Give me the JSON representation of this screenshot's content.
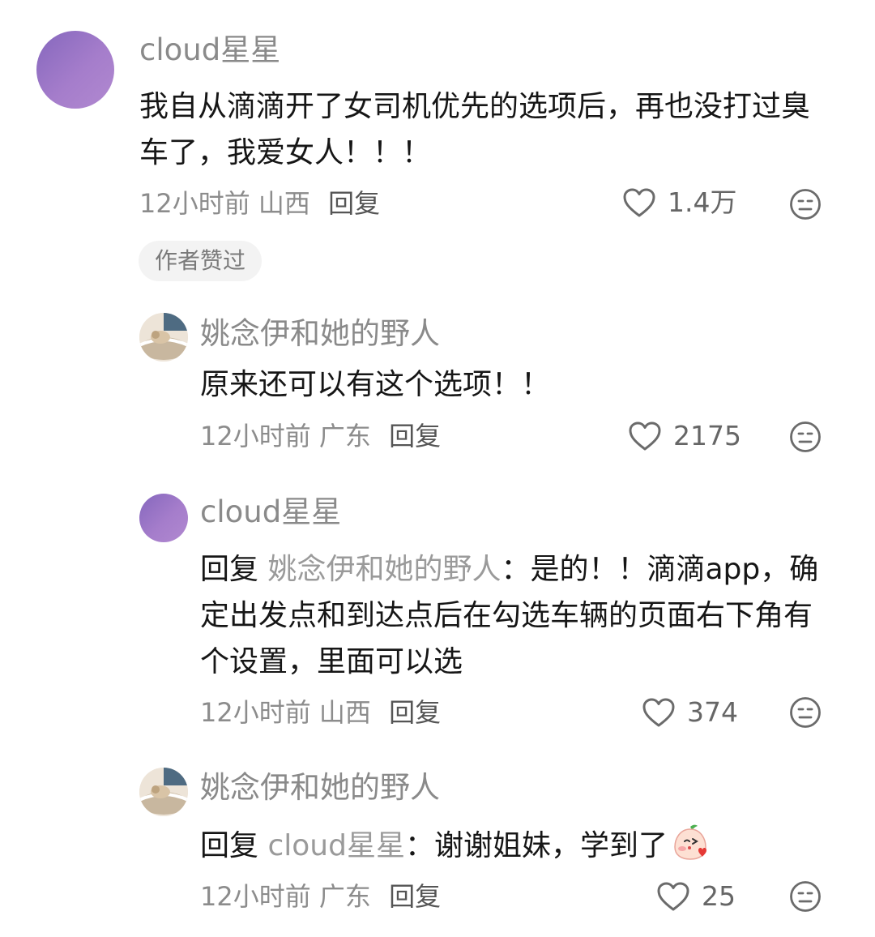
{
  "comments": [
    {
      "username": "cloud星星",
      "text": "我自从滴滴开了女司机优先的选项后，再也没打过臭车了，我爱女人！！！",
      "time": "12小时前",
      "location": "山西",
      "reply_label": "回复",
      "likes": "1.4万",
      "badge": "作者赞过",
      "avatar": "purple-gradient"
    },
    {
      "username": "姚念伊和她的野人",
      "text": "原来还可以有这个选项！！",
      "time": "12小时前",
      "location": "广东",
      "reply_label": "回复",
      "likes": "2175",
      "avatar": "cat-photo"
    },
    {
      "username": "cloud星星",
      "reply_prefix": "回复",
      "reply_to": "姚念伊和她的野人",
      "reply_sep": "：",
      "text": "是的！！滴滴app，确定出发点和到达点后在勾选车辆的页面右下角有个设置，里面可以选",
      "time": "12小时前",
      "location": "山西",
      "reply_label": "回复",
      "likes": "374",
      "avatar": "purple-gradient"
    },
    {
      "username": "姚念伊和她的野人",
      "reply_prefix": "回复",
      "reply_to": "cloud星星",
      "reply_sep": "：",
      "text": "谢谢姐妹，学到了",
      "sticker": "peach-kiss-emoji",
      "time": "12小时前",
      "location": "广东",
      "reply_label": "回复",
      "likes": "25",
      "avatar": "cat-photo"
    }
  ],
  "icons": {
    "like": "heart-outline-icon",
    "more": "meh-face-icon"
  },
  "colors": {
    "avatar_purple": "#9674c6",
    "meta_gray": "#8c8c8c",
    "username_gray": "#8a8a8a"
  }
}
